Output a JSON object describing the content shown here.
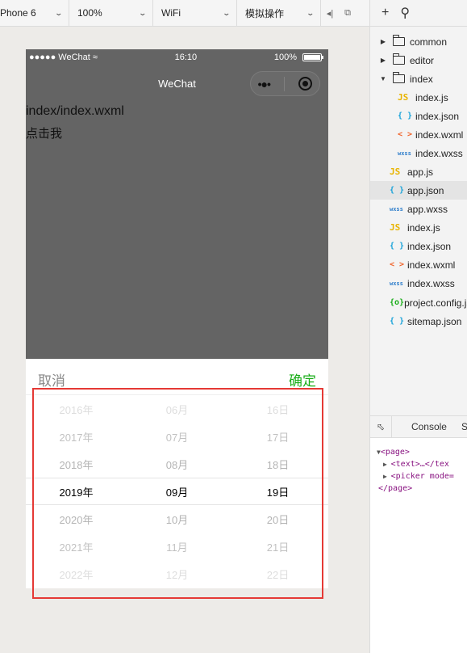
{
  "toolbar": {
    "device": "Phone 6",
    "zoom": "100%",
    "network": "WiFi",
    "operation": "模拟操作"
  },
  "phone": {
    "status": {
      "carrier": "●●●●● WeChat",
      "time": "16:10",
      "battery": "100%"
    },
    "nav_title": "WeChat",
    "content": {
      "line1": "index/index.wxml",
      "line2": "点击我"
    },
    "picker": {
      "cancel": "取消",
      "confirm": "确定",
      "confirm_color": "#1aad19",
      "selected_index": 3,
      "columns": [
        [
          "2016年",
          "2017年",
          "2018年",
          "2019年",
          "2020年",
          "2021年",
          "2022年"
        ],
        [
          "06月",
          "07月",
          "08月",
          "09月",
          "10月",
          "11月",
          "12月"
        ],
        [
          "16日",
          "17日",
          "18日",
          "19日",
          "20日",
          "21日",
          "22日"
        ]
      ]
    }
  },
  "explorer": {
    "items": [
      {
        "name": "common",
        "type": "folder",
        "arrow": "▶",
        "level": 0
      },
      {
        "name": "editor",
        "type": "folder",
        "arrow": "▶",
        "level": 0
      },
      {
        "name": "index",
        "type": "folder-open",
        "arrow": "▼",
        "level": 0
      },
      {
        "name": "index.js",
        "type": "js",
        "level": 1
      },
      {
        "name": "index.json",
        "type": "json",
        "level": 1
      },
      {
        "name": "index.wxml",
        "type": "wxml",
        "level": 1
      },
      {
        "name": "index.wxss",
        "type": "wxss",
        "level": 1
      },
      {
        "name": "app.js",
        "type": "js",
        "level": 0
      },
      {
        "name": "app.json",
        "type": "json",
        "level": 0,
        "selected": true
      },
      {
        "name": "app.wxss",
        "type": "wxss",
        "level": 0
      },
      {
        "name": "index.js",
        "type": "js",
        "level": 0
      },
      {
        "name": "index.json",
        "type": "json",
        "level": 0
      },
      {
        "name": "index.wxml",
        "type": "wxml",
        "level": 0
      },
      {
        "name": "index.wxss",
        "type": "wxss",
        "level": 0
      },
      {
        "name": "project.config.json",
        "type": "cfg",
        "level": 0
      },
      {
        "name": "sitemap.json",
        "type": "json",
        "level": 0
      }
    ],
    "icon_glyphs": {
      "js": "JS",
      "json": "{ }",
      "wxml": "< >",
      "wxss": "wxss",
      "cfg": "{o}"
    }
  },
  "devtools": {
    "tab_console": "Console",
    "tab_next": "S",
    "code": {
      "page_open": "<page>",
      "text_line": "<text>…</tex",
      "picker_line": "<picker mode=",
      "page_close": "</page>"
    }
  }
}
